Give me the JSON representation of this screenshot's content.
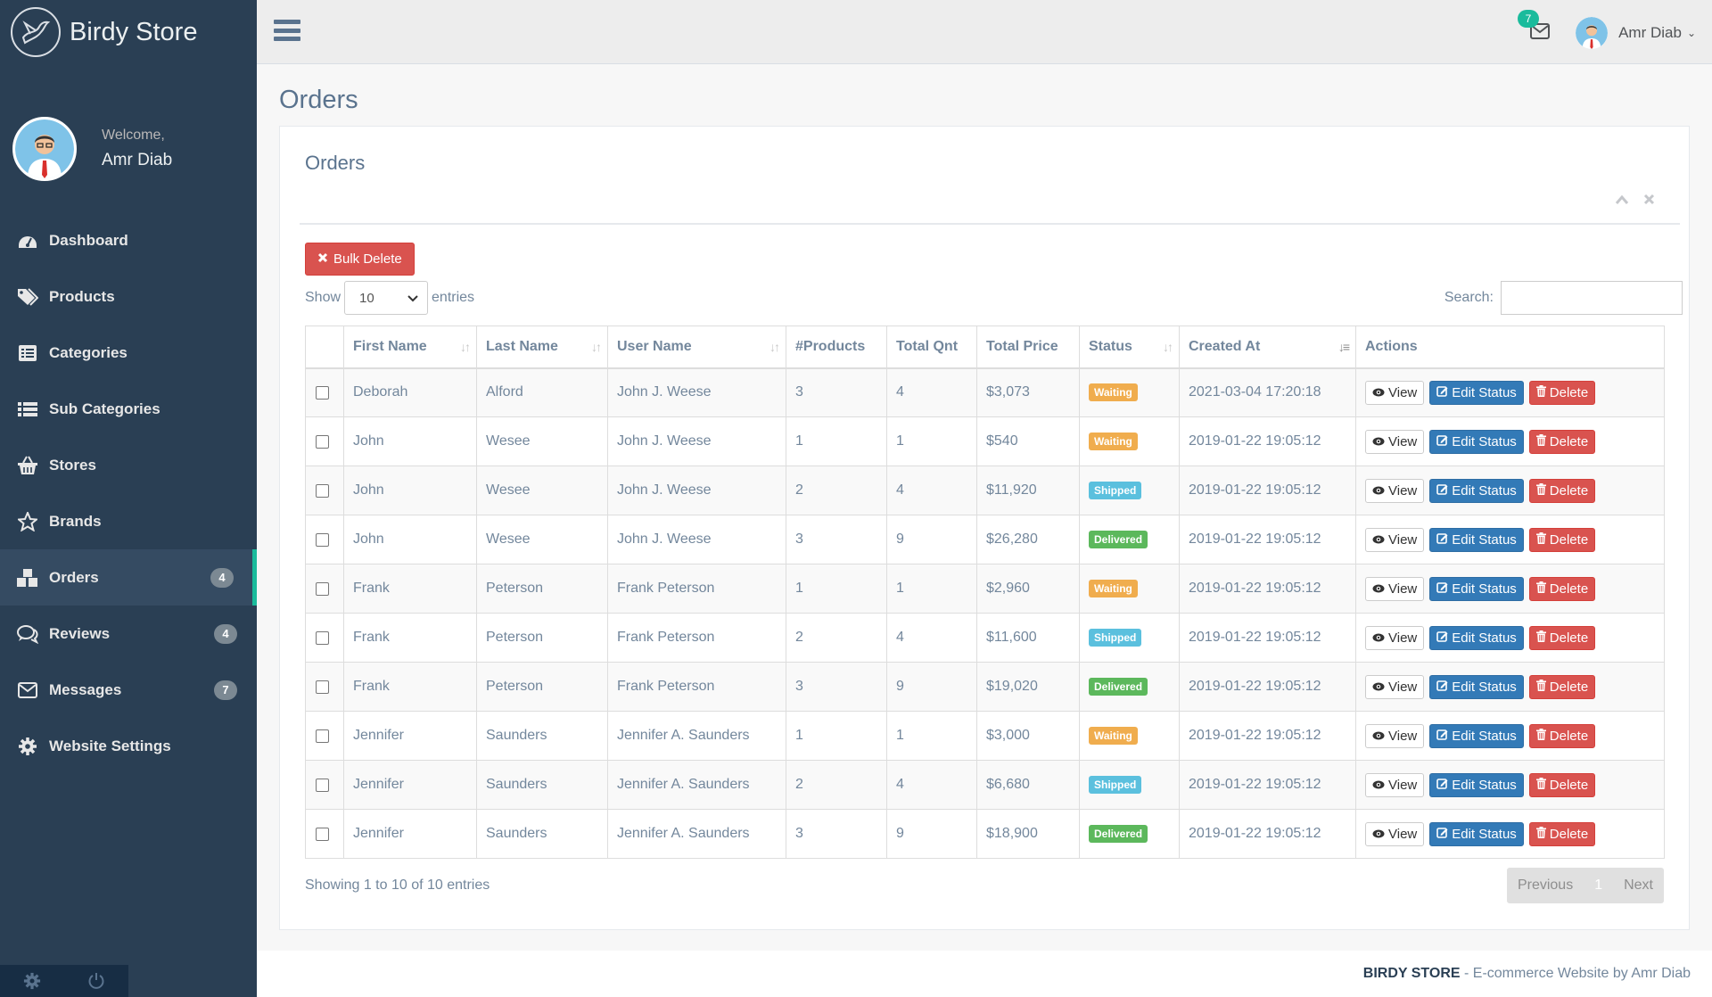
{
  "brand": {
    "title": "Birdy Store"
  },
  "profile": {
    "welcome": "Welcome,",
    "name": "Amr Diab"
  },
  "sidebar": {
    "items": [
      {
        "label": "Dashboard",
        "icon": "dashboard-icon",
        "badge": ""
      },
      {
        "label": "Products",
        "icon": "tags-icon",
        "badge": ""
      },
      {
        "label": "Categories",
        "icon": "list-alt-icon",
        "badge": ""
      },
      {
        "label": "Sub Categories",
        "icon": "list-icon",
        "badge": ""
      },
      {
        "label": "Stores",
        "icon": "basket-icon",
        "badge": ""
      },
      {
        "label": "Brands",
        "icon": "star-icon",
        "badge": ""
      },
      {
        "label": "Orders",
        "icon": "cubes-icon",
        "badge": "4",
        "active": true
      },
      {
        "label": "Reviews",
        "icon": "comments-icon",
        "badge": "4"
      },
      {
        "label": "Messages",
        "icon": "envelope-icon",
        "badge": "7"
      },
      {
        "label": "Website Settings",
        "icon": "gear-icon",
        "badge": ""
      }
    ]
  },
  "topbar": {
    "mail_count": "7",
    "user_name": "Amr Diab"
  },
  "page": {
    "title": "Orders"
  },
  "panel": {
    "title": "Orders",
    "bulk_delete": "Bulk Delete"
  },
  "table_controls": {
    "show": "Show",
    "entries_value": "10",
    "entries": "entries",
    "search_label": "Search:"
  },
  "table": {
    "headers": [
      "First Name",
      "Last Name",
      "User Name",
      "#Products",
      "Total Qnt",
      "Total Price",
      "Status",
      "Created At",
      "Actions"
    ],
    "rows": [
      [
        "Deborah",
        "Alford",
        "John J. Weese",
        "3",
        "4",
        "$3,073",
        "Waiting",
        "2021-03-04 17:20:18"
      ],
      [
        "John",
        "Wesee",
        "John J. Weese",
        "1",
        "1",
        "$540",
        "Waiting",
        "2019-01-22 19:05:12"
      ],
      [
        "John",
        "Wesee",
        "John J. Weese",
        "2",
        "4",
        "$11,920",
        "Shipped",
        "2019-01-22 19:05:12"
      ],
      [
        "John",
        "Wesee",
        "John J. Weese",
        "3",
        "9",
        "$26,280",
        "Delivered",
        "2019-01-22 19:05:12"
      ],
      [
        "Frank",
        "Peterson",
        "Frank Peterson",
        "1",
        "1",
        "$2,960",
        "Waiting",
        "2019-01-22 19:05:12"
      ],
      [
        "Frank",
        "Peterson",
        "Frank Peterson",
        "2",
        "4",
        "$11,600",
        "Shipped",
        "2019-01-22 19:05:12"
      ],
      [
        "Frank",
        "Peterson",
        "Frank Peterson",
        "3",
        "9",
        "$19,020",
        "Delivered",
        "2019-01-22 19:05:12"
      ],
      [
        "Jennifer",
        "Saunders",
        "Jennifer A. Saunders",
        "1",
        "1",
        "$3,000",
        "Waiting",
        "2019-01-22 19:05:12"
      ],
      [
        "Jennifer",
        "Saunders",
        "Jennifer A. Saunders",
        "2",
        "4",
        "$6,680",
        "Shipped",
        "2019-01-22 19:05:12"
      ],
      [
        "Jennifer",
        "Saunders",
        "Jennifer A. Saunders",
        "3",
        "9",
        "$18,900",
        "Delivered",
        "2019-01-22 19:05:12"
      ]
    ],
    "actions": {
      "view": "View",
      "edit": "Edit Status",
      "delete": "Delete"
    }
  },
  "pagination": {
    "info": "Showing 1 to 10 of 10 entries",
    "previous": "Previous",
    "current": "1",
    "next": "Next"
  },
  "footer": {
    "brand": "BIRDY STORE",
    "text": " - E-commerce Website by Amr Diab"
  },
  "colors": {
    "sidebar": "#2a3f54",
    "accent": "#1abb9c",
    "danger": "#d9534f",
    "primary": "#337ab7"
  }
}
